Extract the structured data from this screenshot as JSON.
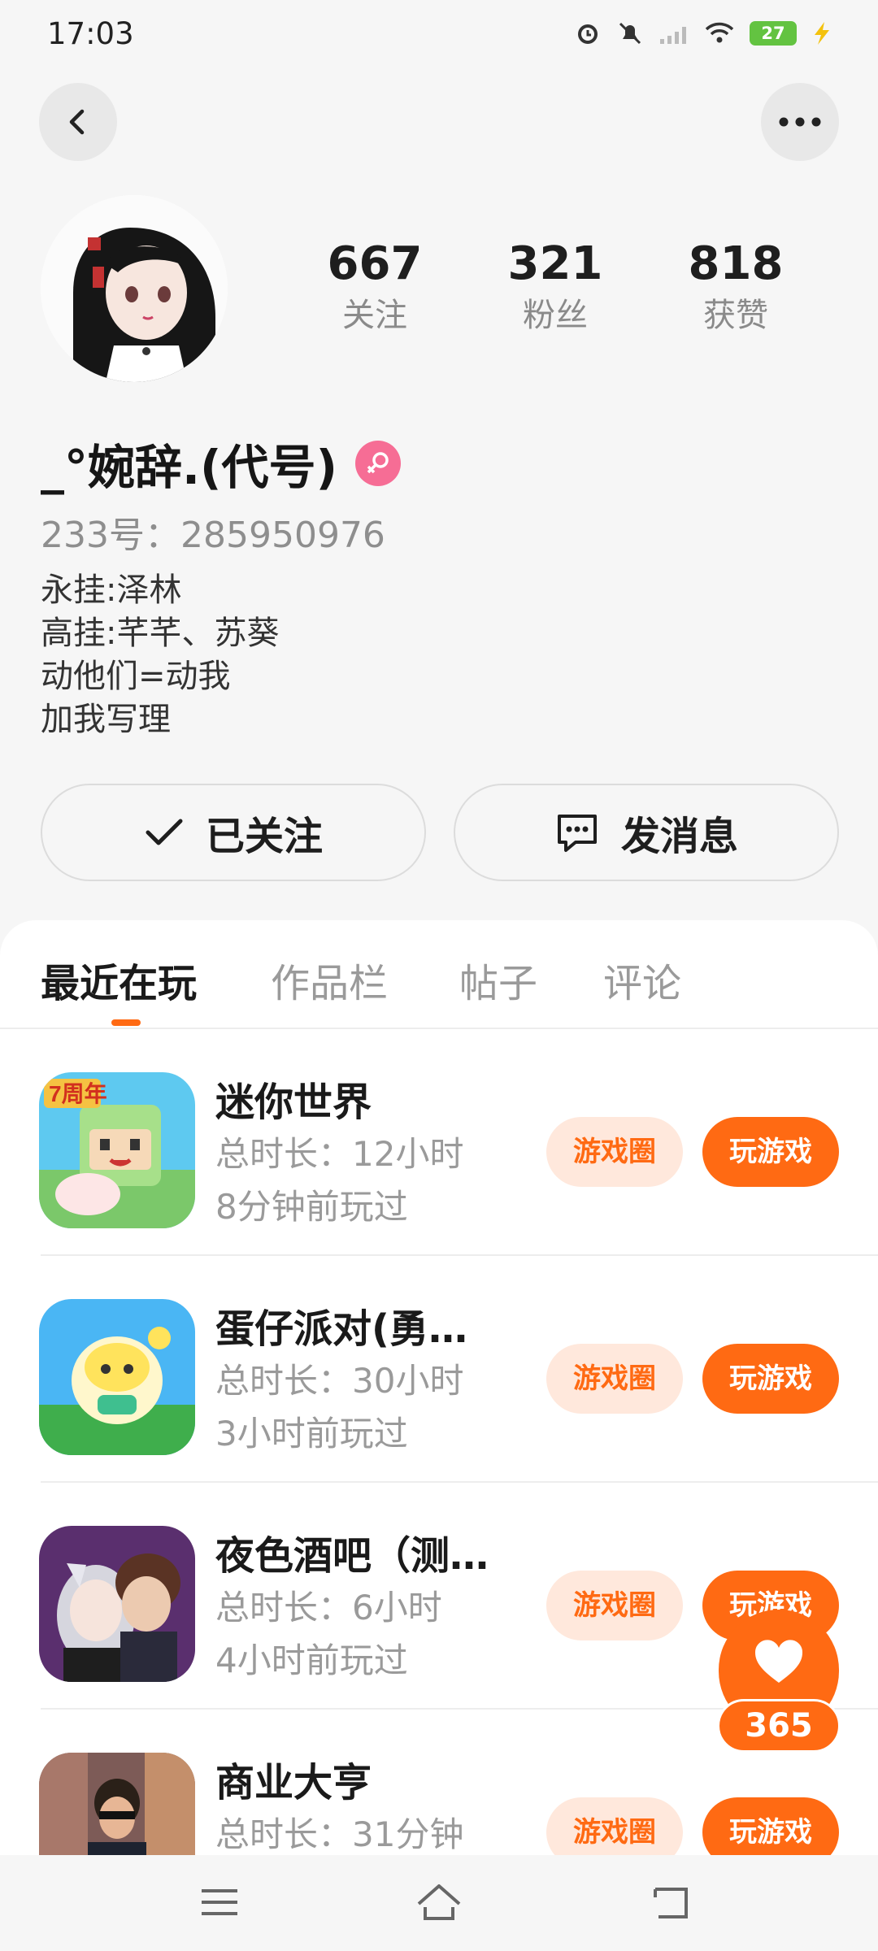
{
  "status_bar": {
    "time": "17:03",
    "battery": "27",
    "icons": [
      "alarm-icon",
      "mute-icon",
      "signal-icon",
      "wifi-icon",
      "battery-icon",
      "charging-icon"
    ]
  },
  "header": {
    "back_icon": "chevron-left-icon",
    "more_icon": "more-dots-icon"
  },
  "profile": {
    "stats": [
      {
        "value": "667",
        "label": "关注"
      },
      {
        "value": "321",
        "label": "粉丝"
      },
      {
        "value": "818",
        "label": "获赞"
      }
    ],
    "name": "_°婉辞.(代号)",
    "gender_icon": "female-icon",
    "uid": "233号：285950976",
    "bio": [
      "永挂:泽林",
      "高挂:芊芊、苏葵",
      "动他们=动我",
      "加我写理"
    ]
  },
  "actions": {
    "follow_label": "已关注",
    "message_label": "发消息"
  },
  "tabs": [
    "最近在玩",
    "作品栏",
    "帖子",
    "评论"
  ],
  "games": [
    {
      "name": "迷你世界",
      "time": "总时长：12小时",
      "last": "8分钟前玩过",
      "circle": "游戏圈",
      "play": "玩游戏"
    },
    {
      "name": "蛋仔派对(勇…",
      "time": "总时长：30小时",
      "last": "3小时前玩过",
      "circle": "游戏圈",
      "play": "玩游戏"
    },
    {
      "name": "夜色酒吧（测…",
      "time": "总时长：6小时",
      "last": "4小时前玩过",
      "circle": "游戏圈",
      "play": "玩游戏"
    },
    {
      "name": "商业大亨",
      "time": "总时长：31分钟",
      "last": "",
      "circle": "游戏圈",
      "play": "玩游戏"
    }
  ],
  "like": {
    "count": "365",
    "icon": "heart-icon"
  },
  "colors": {
    "accent": "#ff6a13",
    "accent_light": "#ffe8dc",
    "gender": "#f66d95"
  }
}
